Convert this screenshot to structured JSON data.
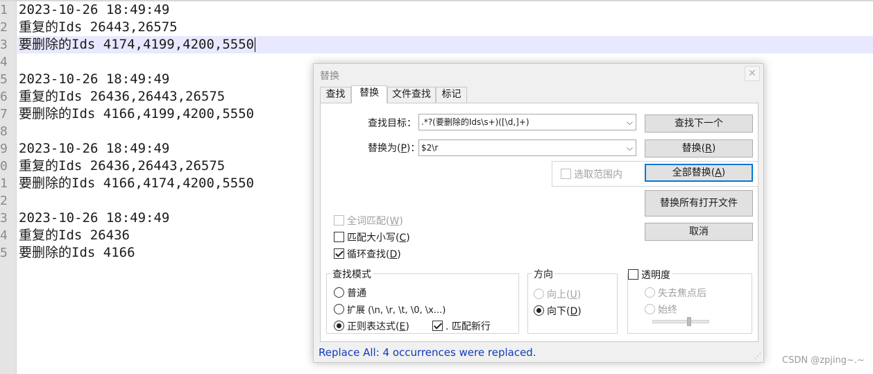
{
  "editor": {
    "line_numbers": [
      "1",
      "2",
      "3",
      "4",
      "5",
      "6",
      "7",
      "8",
      "9",
      "0",
      "1",
      "2",
      "3",
      "4",
      "5"
    ],
    "lines": [
      "2023-10-26 18:49:49",
      "重复的Ids 26443,26575",
      "要删除的Ids 4174,4199,4200,5550",
      "",
      "2023-10-26 18:49:49",
      "重复的Ids 26436,26443,26575",
      "要删除的Ids 4166,4199,4200,5550",
      "",
      "2023-10-26 18:49:49",
      "重复的Ids 26436,26443,26575",
      "要删除的Ids 4166,4174,4200,5550",
      "",
      "2023-10-26 18:49:49",
      "重复的Ids 26436",
      "要删除的Ids 4166"
    ]
  },
  "dialog": {
    "title": "替换",
    "close": "✕",
    "tabs": [
      {
        "label": "查找"
      },
      {
        "label": "替换"
      },
      {
        "label": "文件查找"
      },
      {
        "label": "标记"
      }
    ],
    "find_label": "查找目标：",
    "find_value": ".*?(要删除的Ids\\s+)([\\d,]+)",
    "replace_label_pre": "替换为(",
    "replace_label_key": "P",
    "replace_label_post": ")：",
    "replace_value": "$2\\r",
    "dropdown_arrow": "⌵",
    "in_selection": "选取范围内",
    "buttons": {
      "find_next": "查找下一个",
      "replace_pre": "替换(",
      "replace_key": "R",
      "replace_post": ")",
      "replace_all_pre": "全部替换(",
      "replace_all_key": "A",
      "replace_all_post": ")",
      "replace_all_open": "替换所有打开文件",
      "cancel": "取消"
    },
    "options": {
      "whole_word_pre": "全词匹配(",
      "whole_word_key": "W",
      "match_case_pre": "匹配大小写(",
      "match_case_key": "C",
      "wrap_pre": "循环查找(",
      "wrap_key": "D",
      "close_paren": ")"
    },
    "search_mode": {
      "title": "查找模式",
      "normal": "普通",
      "extended": "扩展 (\\n, \\r, \\t, \\0, \\x...)",
      "regex_pre": "正则表达式(",
      "regex_key": "E",
      "regex_post": ")",
      "dot_newline": ". 匹配新行"
    },
    "direction": {
      "title": "方向",
      "up_pre": "向上(",
      "up_key": "U",
      "down_pre": "向下(",
      "down_key": "D",
      "post": ")"
    },
    "transparency": {
      "title": "透明度",
      "on_lose_focus": "失去焦点后",
      "always": "始终",
      "level": 0.65
    },
    "status": "Replace All: 4 occurrences were replaced.",
    "grip": "⋰"
  },
  "watermark": "CSDN @zpjing~.~"
}
